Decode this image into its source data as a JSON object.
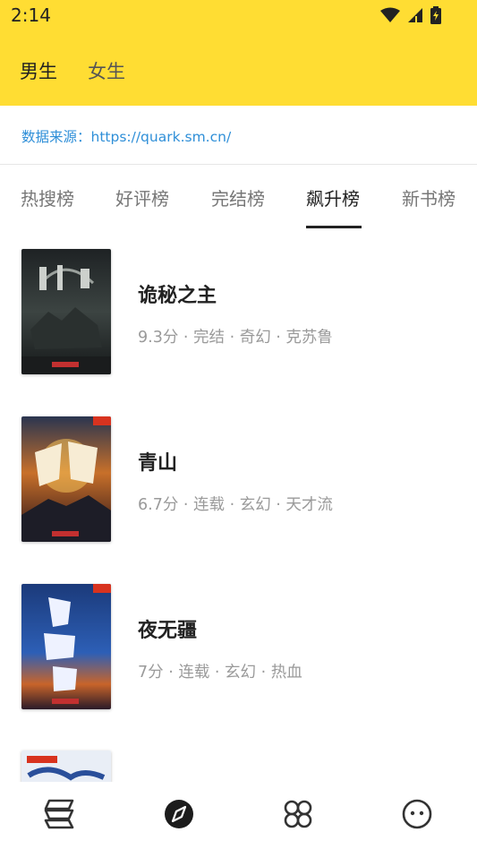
{
  "status_bar": {
    "time": "2:14",
    "icons": [
      "wifi-icon",
      "signal-icon",
      "battery-charging-icon"
    ]
  },
  "gender_tabs": [
    {
      "label": "男生",
      "active": true
    },
    {
      "label": "女生",
      "active": false
    }
  ],
  "source": {
    "text": "数据来源：https://quark.sm.cn/"
  },
  "rank_tabs": [
    {
      "label": "热搜榜",
      "active": false
    },
    {
      "label": "好评榜",
      "active": false
    },
    {
      "label": "完结榜",
      "active": false
    },
    {
      "label": "飙升榜",
      "active": true
    },
    {
      "label": "新书榜",
      "active": false
    }
  ],
  "books": [
    {
      "title": "诡秘之主",
      "meta": "9.3分 · 完结 · 奇幻 · 克苏鲁"
    },
    {
      "title": "青山",
      "meta": "6.7分 · 连载 · 玄幻 · 天才流"
    },
    {
      "title": "夜无疆",
      "meta": "7分 · 连载 · 玄幻 · 热血"
    },
    {
      "title": "",
      "meta": ""
    }
  ],
  "bottom_nav": [
    {
      "icon": "bookshelf-icon",
      "active": false
    },
    {
      "icon": "compass-icon",
      "active": true
    },
    {
      "icon": "category-icon",
      "active": false
    },
    {
      "icon": "profile-face-icon",
      "active": false
    }
  ],
  "colors": {
    "header_bg": "#FFDD33",
    "link": "#2F8FD8",
    "meta_text": "#9A9A9A",
    "title_text": "#222222"
  }
}
